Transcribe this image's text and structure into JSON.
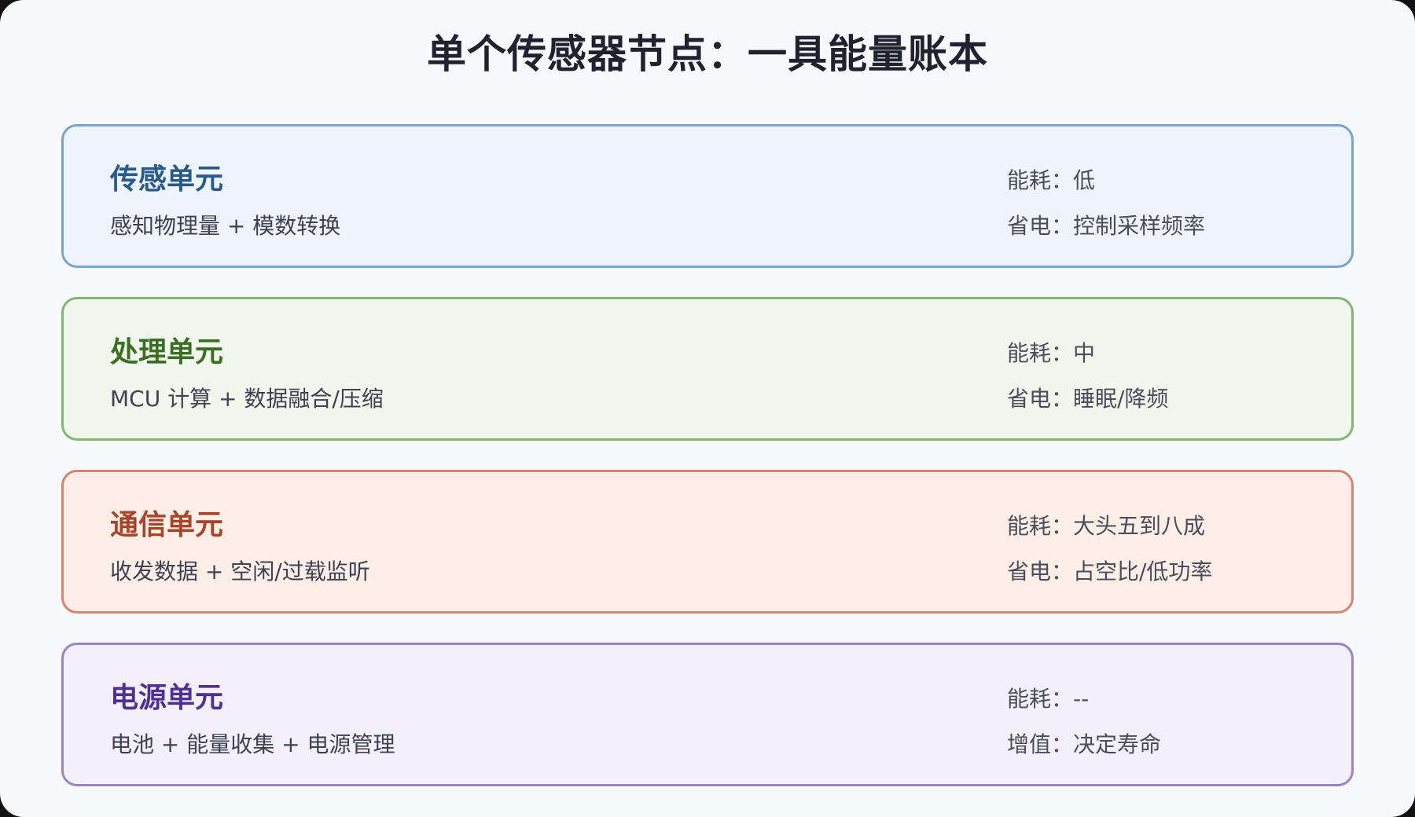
{
  "title": "单个传感器节点：一具能量账本",
  "colors": {
    "sense": "#7aa3cc",
    "processing": "#82b772",
    "communication": "#d9846e",
    "power": "#9a85c4"
  },
  "units": [
    {
      "name": "传感单元",
      "description": "感知物理量 + 模数转换",
      "meta_1": "能耗：低",
      "meta_2": "省电：控制采样频率"
    },
    {
      "name": "处理单元",
      "description": "MCU 计算 + 数据融合/压缩",
      "meta_1": "能耗：中",
      "meta_2": "省电：睡眠/降频"
    },
    {
      "name": "通信单元",
      "description": "收发数据 + 空闲/过载监听",
      "meta_1": "能耗：大头五到八成",
      "meta_2": "省电：占空比/低功率"
    },
    {
      "name": "电源单元",
      "description": "电池 + 能量收集 + 电源管理",
      "meta_1": "能耗：--",
      "meta_2": "增值：决定寿命"
    }
  ]
}
